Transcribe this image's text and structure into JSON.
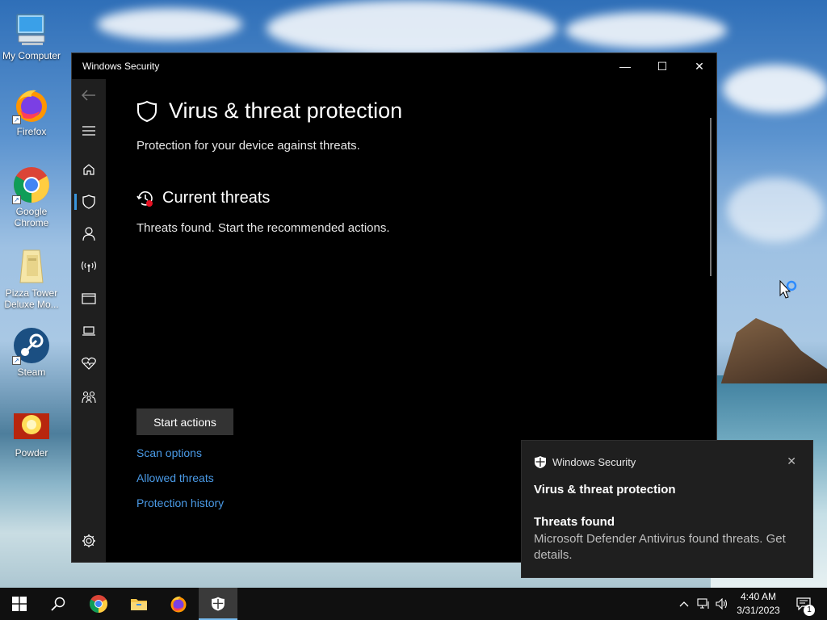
{
  "desktop": {
    "icons": [
      {
        "label": "My Computer",
        "icon": "computer-icon"
      },
      {
        "label": "Firefox",
        "icon": "firefox-icon"
      },
      {
        "label": "Google Chrome",
        "icon": "chrome-icon"
      },
      {
        "label": "Pizza Tower Deluxe Mo...",
        "icon": "folder-icon"
      },
      {
        "label": "Steam",
        "icon": "steam-icon"
      },
      {
        "label": "Powder",
        "icon": "powder-icon"
      }
    ]
  },
  "window": {
    "title": "Windows Security",
    "minimize_glyph": "—",
    "maximize_glyph": "☐",
    "close_glyph": "✕",
    "sidebar": {
      "items": [
        {
          "name": "back-arrow-icon"
        },
        {
          "name": "hamburger-menu-icon"
        },
        {
          "name": "home-icon"
        },
        {
          "name": "shield-icon",
          "active": true
        },
        {
          "name": "person-icon"
        },
        {
          "name": "wireless-icon"
        },
        {
          "name": "app-browser-icon"
        },
        {
          "name": "laptop-icon"
        },
        {
          "name": "heart-icon"
        },
        {
          "name": "family-icon"
        },
        {
          "name": "settings-gear-icon"
        }
      ]
    },
    "heading": "Virus & threat protection",
    "subheading": "Protection for your device against threats.",
    "section_title": "Current threats",
    "section_text": "Threats found. Start the recommended actions.",
    "start_button": "Start actions",
    "links": [
      "Scan options",
      "Allowed threats",
      "Protection history"
    ],
    "link_color": "#4a9ae6"
  },
  "toast": {
    "app_name": "Windows Security",
    "title": "Virus & threat protection",
    "message_title": "Threats found",
    "message_body": "Microsoft Defender Antivirus found threats. Get details.",
    "close_glyph": "✕"
  },
  "taskbar": {
    "apps": [
      "start-windows-icon",
      "search-icon",
      "chrome-icon",
      "file-explorer-icon",
      "firefox-icon",
      "windows-security-icon"
    ],
    "time": "4:40 AM",
    "date": "3/31/2023",
    "notification_count": "1"
  }
}
